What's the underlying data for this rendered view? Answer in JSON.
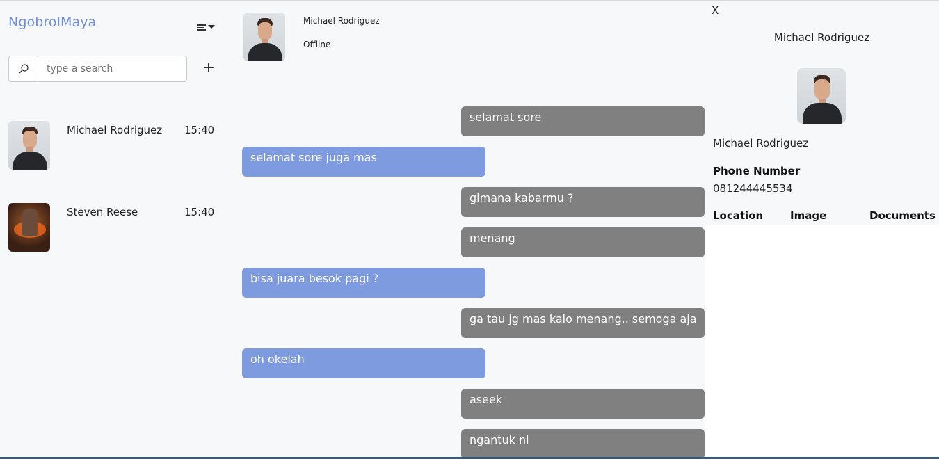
{
  "sidebar": {
    "brand": "NgobrolMaya",
    "search_placeholder": "type a search",
    "contacts": [
      {
        "name": "Michael Rodriguez",
        "time": "15:40"
      },
      {
        "name": "Steven Reese",
        "time": "15:40"
      }
    ]
  },
  "chat": {
    "contact_name": "Michael Rodriguez",
    "status": "Offline",
    "messages": [
      {
        "text": "selamat sore",
        "direction": "out"
      },
      {
        "text": "selamat sore juga mas",
        "direction": "in"
      },
      {
        "text": "gimana kabarmu ?",
        "direction": "out"
      },
      {
        "text": "menang",
        "direction": "out"
      },
      {
        "text": "bisa juara besok pagi ?",
        "direction": "in"
      },
      {
        "text": "ga tau jg mas kalo menang.. semoga aja",
        "direction": "out"
      },
      {
        "text": "oh okelah",
        "direction": "in"
      },
      {
        "text": "aseek",
        "direction": "out"
      },
      {
        "text": "ngantuk ni",
        "direction": "out"
      }
    ]
  },
  "info": {
    "close_label": "X",
    "title": "Michael Rodriguez",
    "name": "Michael Rodriguez",
    "phone_label": "Phone Number",
    "phone_value": "081244445534",
    "tabs": [
      "Location",
      "Image",
      "Documents"
    ]
  },
  "colors": {
    "brand": "#6f8fd0",
    "bubble_out": "#808080",
    "bubble_in": "#7f9be0"
  },
  "icons": {
    "search": "search-icon",
    "menu": "menu-icon",
    "add": "plus-icon"
  }
}
